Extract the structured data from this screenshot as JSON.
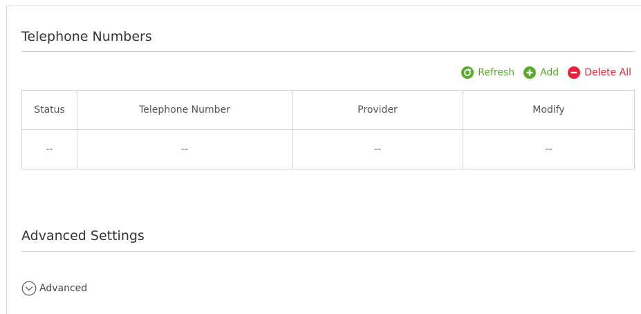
{
  "telephone_section": {
    "title": "Telephone Numbers",
    "toolbar": {
      "refresh_label": "Refresh",
      "add_label": "Add",
      "delete_all_label": "Delete All"
    },
    "table": {
      "headers": [
        "Status",
        "Telephone Number",
        "Provider",
        "Modify"
      ],
      "rows": [
        [
          "--",
          "--",
          "--",
          "--"
        ]
      ]
    }
  },
  "advanced_section": {
    "title": "Advanced Settings",
    "toggle_label": "Advanced"
  },
  "colors": {
    "action_green": "#5aab2c",
    "action_red": "#e8213c",
    "border": "#d2d2d2"
  },
  "icons": {
    "refresh": "refresh-icon",
    "add": "plus-circle-icon",
    "delete_all": "minus-circle-icon",
    "advanced": "chevron-down-circle-icon"
  }
}
